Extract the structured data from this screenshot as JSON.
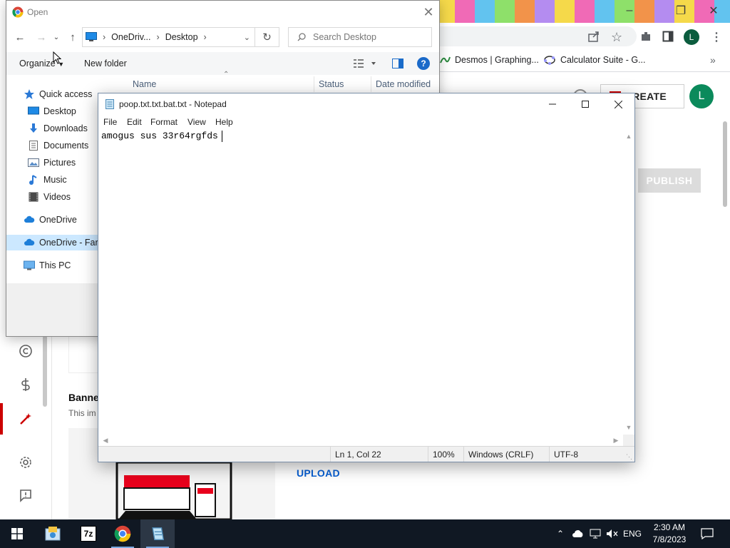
{
  "browser": {
    "bookmarks": [
      {
        "label": "Desmos | Graphing...",
        "icon": "desmos-icon"
      },
      {
        "label": "Calculator Suite - G...",
        "icon": "geogebra-icon"
      }
    ],
    "profile_initial": "L",
    "create_label": "CREATE",
    "avatar_initial": "L",
    "publish_label": "PUBLISH",
    "banner_title": "Banne",
    "banner_sub": "This im",
    "upload_label": "UPLOAD"
  },
  "open_dialog": {
    "title": "Open",
    "breadcrumb": [
      "OneDriv...",
      "Desktop"
    ],
    "search_placeholder": "Search Desktop",
    "organize_label": "Organize",
    "new_folder_label": "New folder",
    "columns": [
      "Name",
      "Status",
      "Date modified"
    ],
    "nav": [
      {
        "label": "Quick access",
        "icon": "star-icon"
      },
      {
        "label": "Desktop",
        "icon": "desktop-icon"
      },
      {
        "label": "Downloads",
        "icon": "download-icon"
      },
      {
        "label": "Documents",
        "icon": "document-icon"
      },
      {
        "label": "Pictures",
        "icon": "picture-icon"
      },
      {
        "label": "Music",
        "icon": "music-icon"
      },
      {
        "label": "Videos",
        "icon": "video-icon"
      },
      {
        "label": "OneDrive",
        "icon": "cloud-icon"
      },
      {
        "label": "OneDrive - Farn",
        "icon": "cloud-icon"
      },
      {
        "label": "This PC",
        "icon": "computer-icon"
      }
    ]
  },
  "notepad": {
    "title": "poop.txt.txt.bat.txt - Notepad",
    "menu": [
      "File",
      "Edit",
      "Format",
      "View",
      "Help"
    ],
    "content": "amogus sus 33r64rgfds",
    "status": {
      "position": "Ln 1, Col 22",
      "zoom": "100%",
      "line_ending": "Windows (CRLF)",
      "encoding": "UTF-8"
    }
  },
  "taskbar": {
    "apps": [
      "start-icon",
      "file-explorer-icon",
      "7zip-icon",
      "chrome-icon",
      "notepad-icon"
    ],
    "language": "ENG",
    "time": "2:30 AM",
    "date": "7/8/2023",
    "sevenzip_label": "7z"
  },
  "colors": {
    "accent_blue": "#065fd4",
    "selection": "#cce8ff",
    "taskbar": "#101823",
    "youtube_red": "#cc0000"
  }
}
